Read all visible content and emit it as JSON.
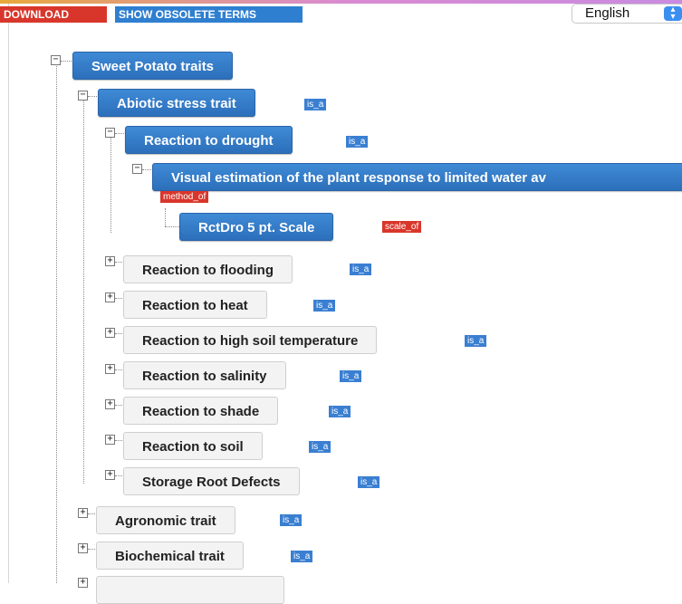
{
  "toolbar": {
    "download_label": "DOWNLOAD",
    "obsolete_label": "SHOW OBSOLETE TERMS",
    "language_selected": "English",
    "download_color": "#d9362b",
    "obsolete_color": "#2f7fd0"
  },
  "tree": {
    "root": {
      "label": "Sweet Potato traits",
      "expander": "−"
    },
    "abiotic": {
      "label": "Abiotic stress trait",
      "badge": "is_a",
      "expander": "−"
    },
    "drought": {
      "label": "Reaction to drought",
      "badge": "is_a",
      "expander": "−"
    },
    "visual": {
      "label": "Visual estimation of the plant response to limited water av",
      "badge": "method_of",
      "expander": "−"
    },
    "scale": {
      "label": "RctDro 5 pt. Scale",
      "badge": "scale_of"
    },
    "flooding": {
      "label": "Reaction to flooding",
      "badge": "is_a",
      "expander": "+"
    },
    "heat": {
      "label": "Reaction to heat",
      "badge": "is_a",
      "expander": "+"
    },
    "soiltemp": {
      "label": "Reaction to high soil temperature",
      "badge": "is_a",
      "expander": "+"
    },
    "salinity": {
      "label": "Reaction to salinity",
      "badge": "is_a",
      "expander": "+"
    },
    "shade": {
      "label": "Reaction to shade",
      "badge": "is_a",
      "expander": "+"
    },
    "soil": {
      "label": "Reaction to soil",
      "badge": "is_a",
      "expander": "+"
    },
    "storage": {
      "label": "Storage Root Defects",
      "badge": "is_a",
      "expander": "+"
    },
    "agronomic": {
      "label": "Agronomic trait",
      "badge": "is_a",
      "expander": "+"
    },
    "biochemical": {
      "label": "Biochemical trait",
      "badge": "is_a",
      "expander": "+"
    }
  },
  "colors": {
    "node_blue": "#2f76c6",
    "badge_blue": "#3a7fd1",
    "badge_red": "#d9362b"
  },
  "icons": {
    "expand": "plus-box-icon",
    "collapse": "minus-box-icon",
    "dropdown": "updown-arrow-icon"
  }
}
